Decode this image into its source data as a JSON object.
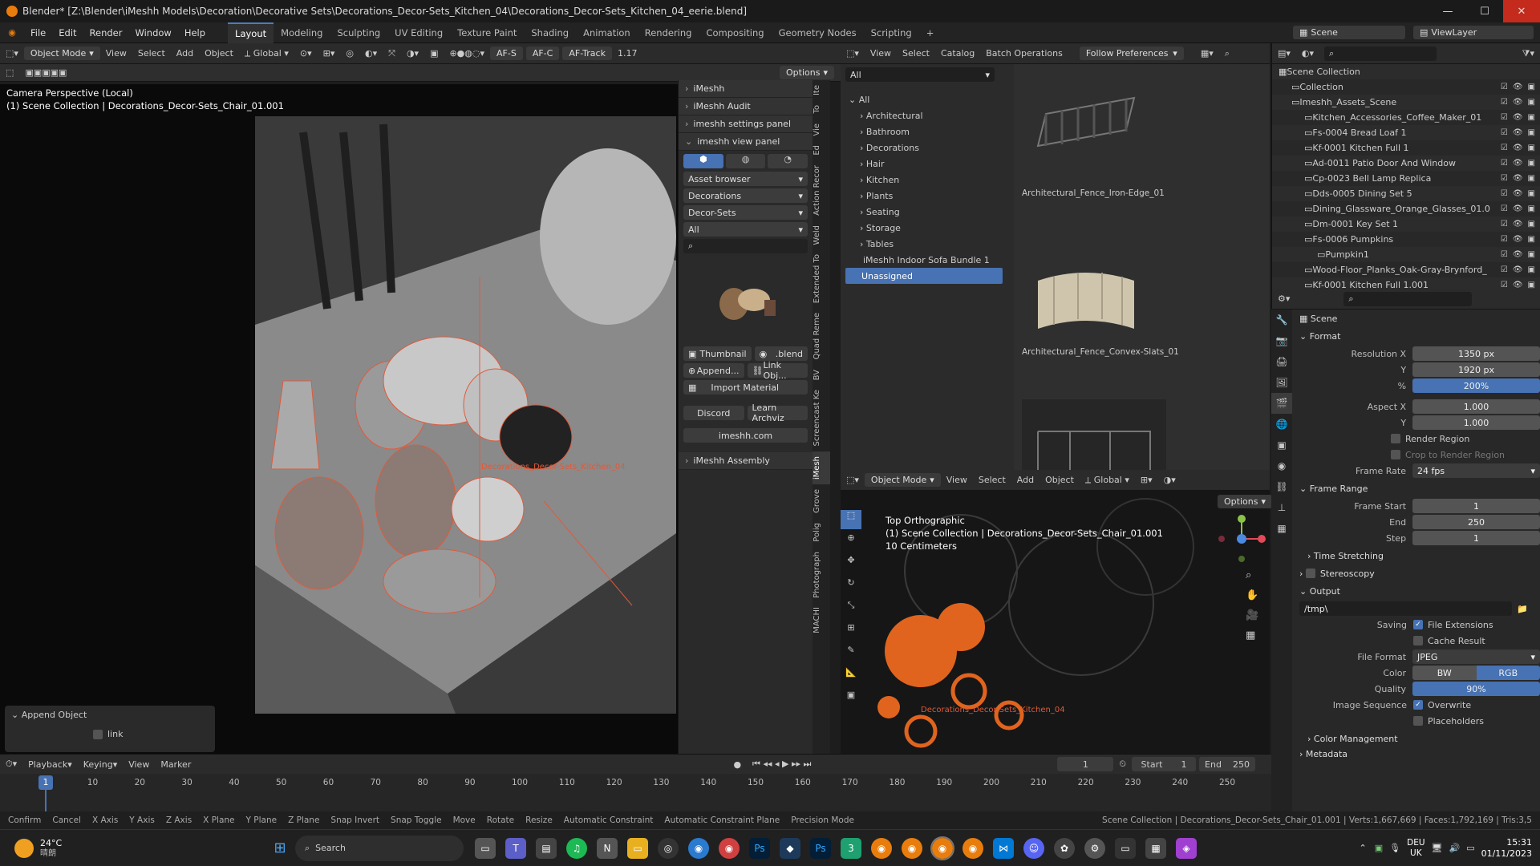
{
  "window": {
    "title": "Blender* [Z:\\Blender\\iMeshh Models\\Decoration\\Decorative Sets\\Decorations_Decor-Sets_Kitchen_04\\Decorations_Decor-Sets_Kitchen_04_eerie.blend]"
  },
  "menu": [
    "File",
    "Edit",
    "Render",
    "Window",
    "Help"
  ],
  "workspaces": [
    "Layout",
    "Modeling",
    "Sculpting",
    "UV Editing",
    "Texture Paint",
    "Shading",
    "Animation",
    "Rendering",
    "Compositing",
    "Geometry Nodes",
    "Scripting"
  ],
  "top_right": {
    "scene": "Scene",
    "view_layer": "ViewLayer"
  },
  "viewport": {
    "mode": "Object Mode",
    "menus": [
      "View",
      "Select",
      "Add",
      "Object"
    ],
    "orientation": "Global",
    "af_s": "AF-S",
    "af_c": "AF-C",
    "af_track": "AF-Track",
    "lens": "1.17",
    "options": "Options",
    "overlay_title": "Camera Perspective (Local)",
    "overlay_sub": "(1) Scene Collection | Decorations_Decor-Sets_Chair_01.001",
    "object_label": "Decorations_Decor-Sets_Kitchen_04",
    "append": "Append Object",
    "link": "link"
  },
  "npanel": {
    "sections": [
      "iMeshh",
      "iMeshh Audit",
      "imeshh settings panel",
      "imeshh view panel"
    ],
    "asset_browser": "Asset browser",
    "category": "Decorations",
    "subcategory": "Decor-Sets",
    "filter": "All",
    "thumbnail": "Thumbnail",
    ".blend": ".blend",
    "append": "Append...",
    "link_obj": "Link Obj...",
    "import_material": "Import Material",
    "discord": "Discord",
    "learn_archviz": "Learn Archviz",
    "site": "imeshh.com",
    "assembly": "iMeshh Assembly"
  },
  "vtabs": [
    "Ite",
    "To",
    "Vie",
    "Ed",
    "Action Recor",
    "Weld",
    "Extended To",
    "Quad Reme",
    "BV",
    "Screencast Ke",
    "iMesh",
    "Grove",
    "Polig",
    "Photograph",
    "MACHI"
  ],
  "asset_browser": {
    "menus": [
      "View",
      "Select",
      "Catalog",
      "Batch Operations"
    ],
    "follow": "Follow Preferences",
    "library": "All",
    "root": "All",
    "categories": [
      "Architectural",
      "Bathroom",
      "Decorations",
      "Hair",
      "Kitchen",
      "Plants",
      "Seating",
      "Storage",
      "Tables"
    ],
    "bundle": "iMeshh Indoor Sofa Bundle 1",
    "unassigned": "Unassigned",
    "items": [
      "Architectural_Fence_Iron-Edge_01",
      "Architectural_Fence_Convex-Slats_01"
    ]
  },
  "viewport2": {
    "mode": "Object Mode",
    "menus": [
      "View",
      "Select",
      "Add",
      "Object"
    ],
    "orientation": "Global",
    "options": "Options",
    "title": "Top Orthographic",
    "sub": "(1) Scene Collection | Decorations_Decor-Sets_Chair_01.001",
    "scale": "10 Centimeters",
    "label": "Decorations_Decor-Sets_Kitchen_04"
  },
  "outliner": {
    "rows": [
      {
        "name": "Scene Collection",
        "indent": 0
      },
      {
        "name": "Collection",
        "indent": 1
      },
      {
        "name": "Imeshh_Assets_Scene",
        "indent": 1
      },
      {
        "name": "Kitchen_Accessories_Coffee_Maker_01",
        "indent": 2
      },
      {
        "name": "Fs-0004 Bread Loaf 1",
        "indent": 2
      },
      {
        "name": "Kf-0001 Kitchen Full 1",
        "indent": 2
      },
      {
        "name": "Ad-0011 Patio Door And Window",
        "indent": 2
      },
      {
        "name": "Cp-0023 Bell Lamp Replica",
        "indent": 2
      },
      {
        "name": "Dds-0005 Dining Set 5",
        "indent": 2
      },
      {
        "name": "Dining_Glassware_Orange_Glasses_01.0",
        "indent": 2
      },
      {
        "name": "Dm-0001 Key Set 1",
        "indent": 2
      },
      {
        "name": "Fs-0006 Pumpkins",
        "indent": 2
      },
      {
        "name": "Pumpkin1",
        "indent": 3
      },
      {
        "name": "Wood-Floor_Planks_Oak-Gray-Brynford_",
        "indent": 2
      },
      {
        "name": "Kf-0001 Kitchen Full 1.001",
        "indent": 2
      }
    ]
  },
  "properties": {
    "context": "Scene",
    "format": "Format",
    "res_x_label": "Resolution X",
    "res_x": "1350 px",
    "res_y_label": "Y",
    "res_y": "1920 px",
    "pct_label": "%",
    "pct": "200%",
    "aspect_x_label": "Aspect X",
    "aspect_x": "1.000",
    "aspect_y_label": "Y",
    "aspect_y": "1.000",
    "render_region": "Render Region",
    "crop": "Crop to Render Region",
    "frame_rate_label": "Frame Rate",
    "frame_rate": "24 fps",
    "frame_range": "Frame Range",
    "start_label": "Frame Start",
    "start": "1",
    "end_label": "End",
    "end": "250",
    "step_label": "Step",
    "step": "1",
    "time_stretching": "Time Stretching",
    "stereoscopy": "Stereoscopy",
    "output": "Output",
    "path": "/tmp\\",
    "saving": "Saving",
    "file_ext": "File Extensions",
    "cache": "Cache Result",
    "file_format_label": "File Format",
    "file_format": "JPEG",
    "color_label": "Color",
    "bw": "BW",
    "rgb": "RGB",
    "quality_label": "Quality",
    "quality": "90%",
    "image_seq": "Image Sequence",
    "overwrite": "Overwrite",
    "placeholders": "Placeholders",
    "color_mgmt": "Color Management",
    "metadata": "Metadata"
  },
  "timeline": {
    "menus": [
      "Playback",
      "Keying",
      "View",
      "Marker"
    ],
    "current": "1",
    "start_label": "Start",
    "start": "1",
    "end_label": "End",
    "end": "250",
    "ticks": [
      "1",
      "10",
      "20",
      "30",
      "40",
      "50",
      "60",
      "70",
      "80",
      "90",
      "100",
      "110",
      "120",
      "130",
      "140",
      "150",
      "160",
      "170",
      "180",
      "190",
      "200",
      "210",
      "220",
      "230",
      "240",
      "250"
    ]
  },
  "status": {
    "items": [
      "Confirm",
      "Cancel",
      "X Axis",
      "Y Axis",
      "Z Axis",
      "X Plane",
      "Y Plane",
      "Z Plane",
      "Snap Invert",
      "Snap Toggle",
      "Move",
      "Rotate",
      "Resize",
      "Automatic Constraint",
      "Automatic Constraint Plane",
      "Precision Mode"
    ],
    "right": "Scene Collection | Decorations_Decor-Sets_Chair_01.001 | Verts:1,667,669 | Faces:1,792,169 | Tris:3,5"
  },
  "taskbar": {
    "temp": "24°C",
    "weather": "晴朗",
    "search": "Search",
    "lang1": "DEU",
    "lang2": "UK",
    "time": "15:31",
    "date": "01/11/2023"
  }
}
